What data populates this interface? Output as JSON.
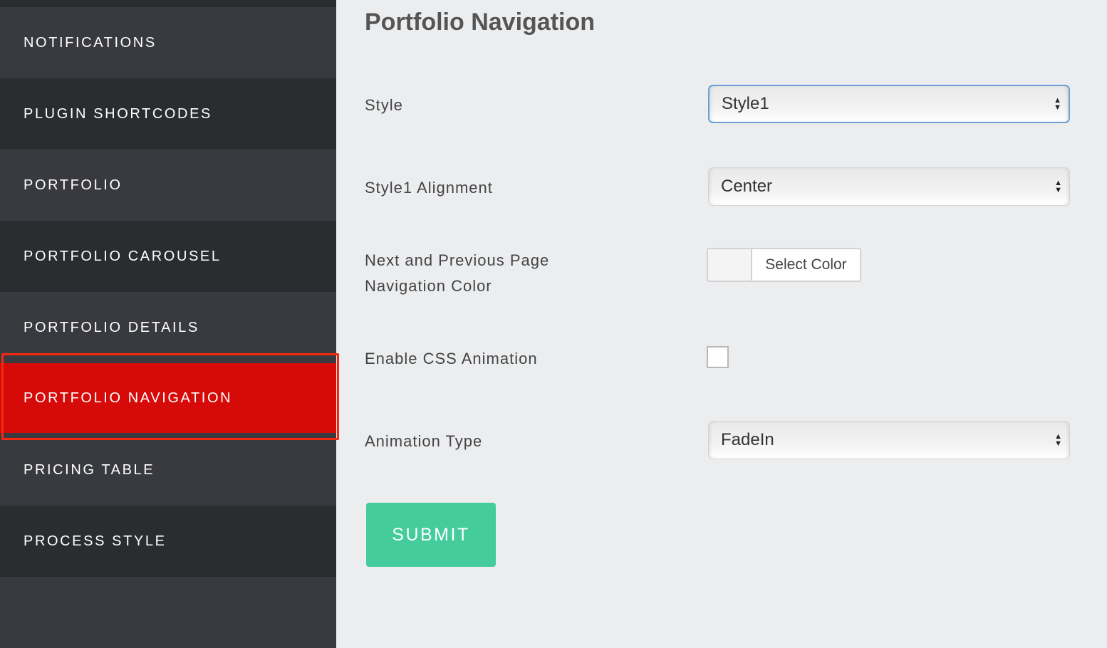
{
  "sidebar": {
    "items": [
      {
        "label": "NOTIFICATIONS"
      },
      {
        "label": "PLUGIN SHORTCODES"
      },
      {
        "label": "PORTFOLIO"
      },
      {
        "label": "PORTFOLIO CAROUSEL"
      },
      {
        "label": "PORTFOLIO DETAILS"
      },
      {
        "label": "PORTFOLIO NAVIGATION",
        "active": true
      },
      {
        "label": "PRICING TABLE"
      },
      {
        "label": "PROCESS STYLE"
      }
    ]
  },
  "main": {
    "title": "Portfolio Navigation",
    "fields": {
      "style": {
        "label": "Style",
        "value": "Style1"
      },
      "alignment": {
        "label": "Style1 Alignment",
        "value": "Center"
      },
      "nav_color": {
        "label_line1": "Next and Previous Page",
        "label_line2": "Navigation Color",
        "button_label": "Select Color"
      },
      "css_animation": {
        "label": "Enable CSS Animation",
        "checked": false
      },
      "animation_type": {
        "label": "Animation Type",
        "value": "FadeIn"
      }
    },
    "submit_label": "SUBMIT"
  },
  "colors": {
    "active_item": "#d60a08",
    "submit": "#44cc9c",
    "focus_border": "#6a9fd6"
  }
}
